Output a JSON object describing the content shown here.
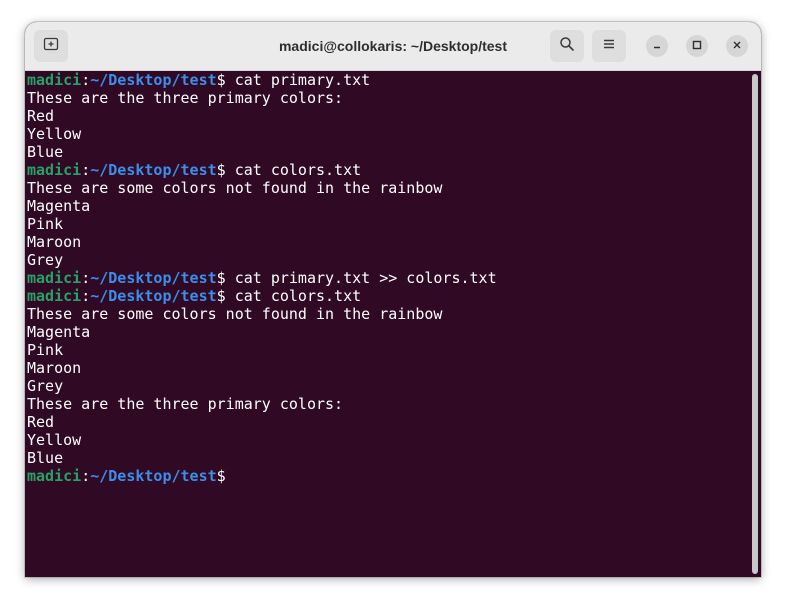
{
  "window": {
    "title": "madici@collokaris: ~/Desktop/test"
  },
  "titlebar": {
    "new_tab_icon": "new-tab-icon",
    "search_icon": "search-icon",
    "menu_icon": "hamburger-menu-icon",
    "minimize_icon": "minimize-icon",
    "maximize_icon": "maximize-icon",
    "close_icon": "close-icon"
  },
  "prompt": {
    "user": "madici",
    "sep": ":",
    "path": "~/Desktop/test",
    "symbol": "$"
  },
  "terminal": {
    "lines": [
      {
        "type": "prompt",
        "command": " cat primary.txt"
      },
      {
        "type": "output",
        "text": "These are the three primary colors:"
      },
      {
        "type": "output",
        "text": "Red"
      },
      {
        "type": "output",
        "text": "Yellow"
      },
      {
        "type": "output",
        "text": "Blue"
      },
      {
        "type": "prompt",
        "command": " cat colors.txt"
      },
      {
        "type": "output",
        "text": "These are some colors not found in the rainbow"
      },
      {
        "type": "output",
        "text": "Magenta"
      },
      {
        "type": "output",
        "text": "Pink"
      },
      {
        "type": "output",
        "text": "Maroon"
      },
      {
        "type": "output",
        "text": "Grey"
      },
      {
        "type": "prompt",
        "command": " cat primary.txt >> colors.txt"
      },
      {
        "type": "prompt",
        "command": " cat colors.txt"
      },
      {
        "type": "output",
        "text": "These are some colors not found in the rainbow"
      },
      {
        "type": "output",
        "text": "Magenta"
      },
      {
        "type": "output",
        "text": "Pink"
      },
      {
        "type": "output",
        "text": "Maroon"
      },
      {
        "type": "output",
        "text": "Grey"
      },
      {
        "type": "output",
        "text": "These are the three primary colors:"
      },
      {
        "type": "output",
        "text": "Red"
      },
      {
        "type": "output",
        "text": "Yellow"
      },
      {
        "type": "output",
        "text": "Blue"
      },
      {
        "type": "prompt",
        "command": ""
      }
    ]
  },
  "colors": {
    "background": "#300a24",
    "user": "#26a269",
    "path": "#3b8eea",
    "text": "#ffffff",
    "titlebar": "#ebebeb"
  }
}
